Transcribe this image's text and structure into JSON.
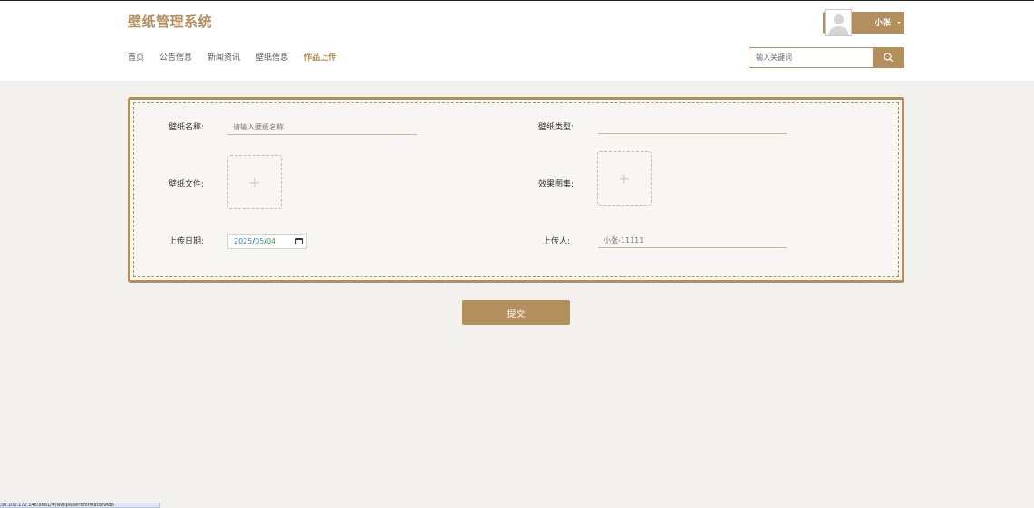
{
  "header": {
    "site_title": "壁纸管理系统",
    "nav": [
      {
        "label": "首页",
        "active": false
      },
      {
        "label": "公告信息",
        "active": false
      },
      {
        "label": "新闻资讯",
        "active": false
      },
      {
        "label": "壁纸信息",
        "active": false
      },
      {
        "label": "作品上传",
        "active": true
      }
    ],
    "user": {
      "name": "小张",
      "avatar_icon": "user-avatar-icon"
    },
    "search": {
      "placeholder": "输入关键词",
      "icon": "search-icon"
    }
  },
  "form": {
    "name_label": "壁纸名称:",
    "name_placeholder": "请输入壁纸名称",
    "type_label": "壁纸类型:",
    "type_value": "",
    "file_label": "壁纸文件:",
    "preview_label": "效果图集:",
    "upload_icon": "+",
    "date_label": "上传日期:",
    "date_year": "2025",
    "date_month": "05",
    "date_day": "04",
    "uploader_label": "上传人:",
    "uploader_placeholder": "小张-11111"
  },
  "submit_label": "提交",
  "status_bar_text": "30.100.172.146:8081/#/wallpaperinformationAdd",
  "colors": {
    "accent": "#b38f5d",
    "background": "#f2f1ee"
  }
}
